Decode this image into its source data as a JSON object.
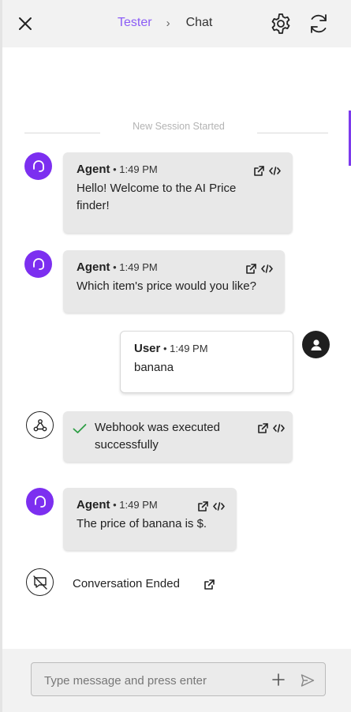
{
  "header": {
    "breadcrumb": [
      "Tester",
      "Chat"
    ],
    "separator": "›"
  },
  "session_banner": "New Session Started",
  "messages": [
    {
      "role": "Agent",
      "time": "• 1:49 PM",
      "text": "Hello! Welcome to the AI Price finder!"
    },
    {
      "role": "Agent",
      "time": "• 1:49 PM",
      "text": "Which item's price would you like?"
    },
    {
      "role": "User",
      "time": "• 1:49 PM",
      "text": "banana"
    },
    {
      "role": "Agent",
      "time": "• 1:49 PM",
      "text": "The price of banana is $."
    }
  ],
  "webhook": {
    "text": "Webhook was executed successfully",
    "status_color": "#2e9e45"
  },
  "conversation_ended": "Conversation Ended",
  "composer": {
    "placeholder": "Type message and press enter"
  },
  "colors": {
    "accent": "#8b5cf6",
    "agent_avatar": "#7c2ff0"
  },
  "icons": [
    "close-icon",
    "settings-gear-icon",
    "refresh-icon",
    "headset-icon",
    "user-icon",
    "webhook-icon",
    "conversation-ended-icon",
    "open-external-icon",
    "code-icon",
    "check-icon",
    "plus-icon",
    "send-icon"
  ]
}
